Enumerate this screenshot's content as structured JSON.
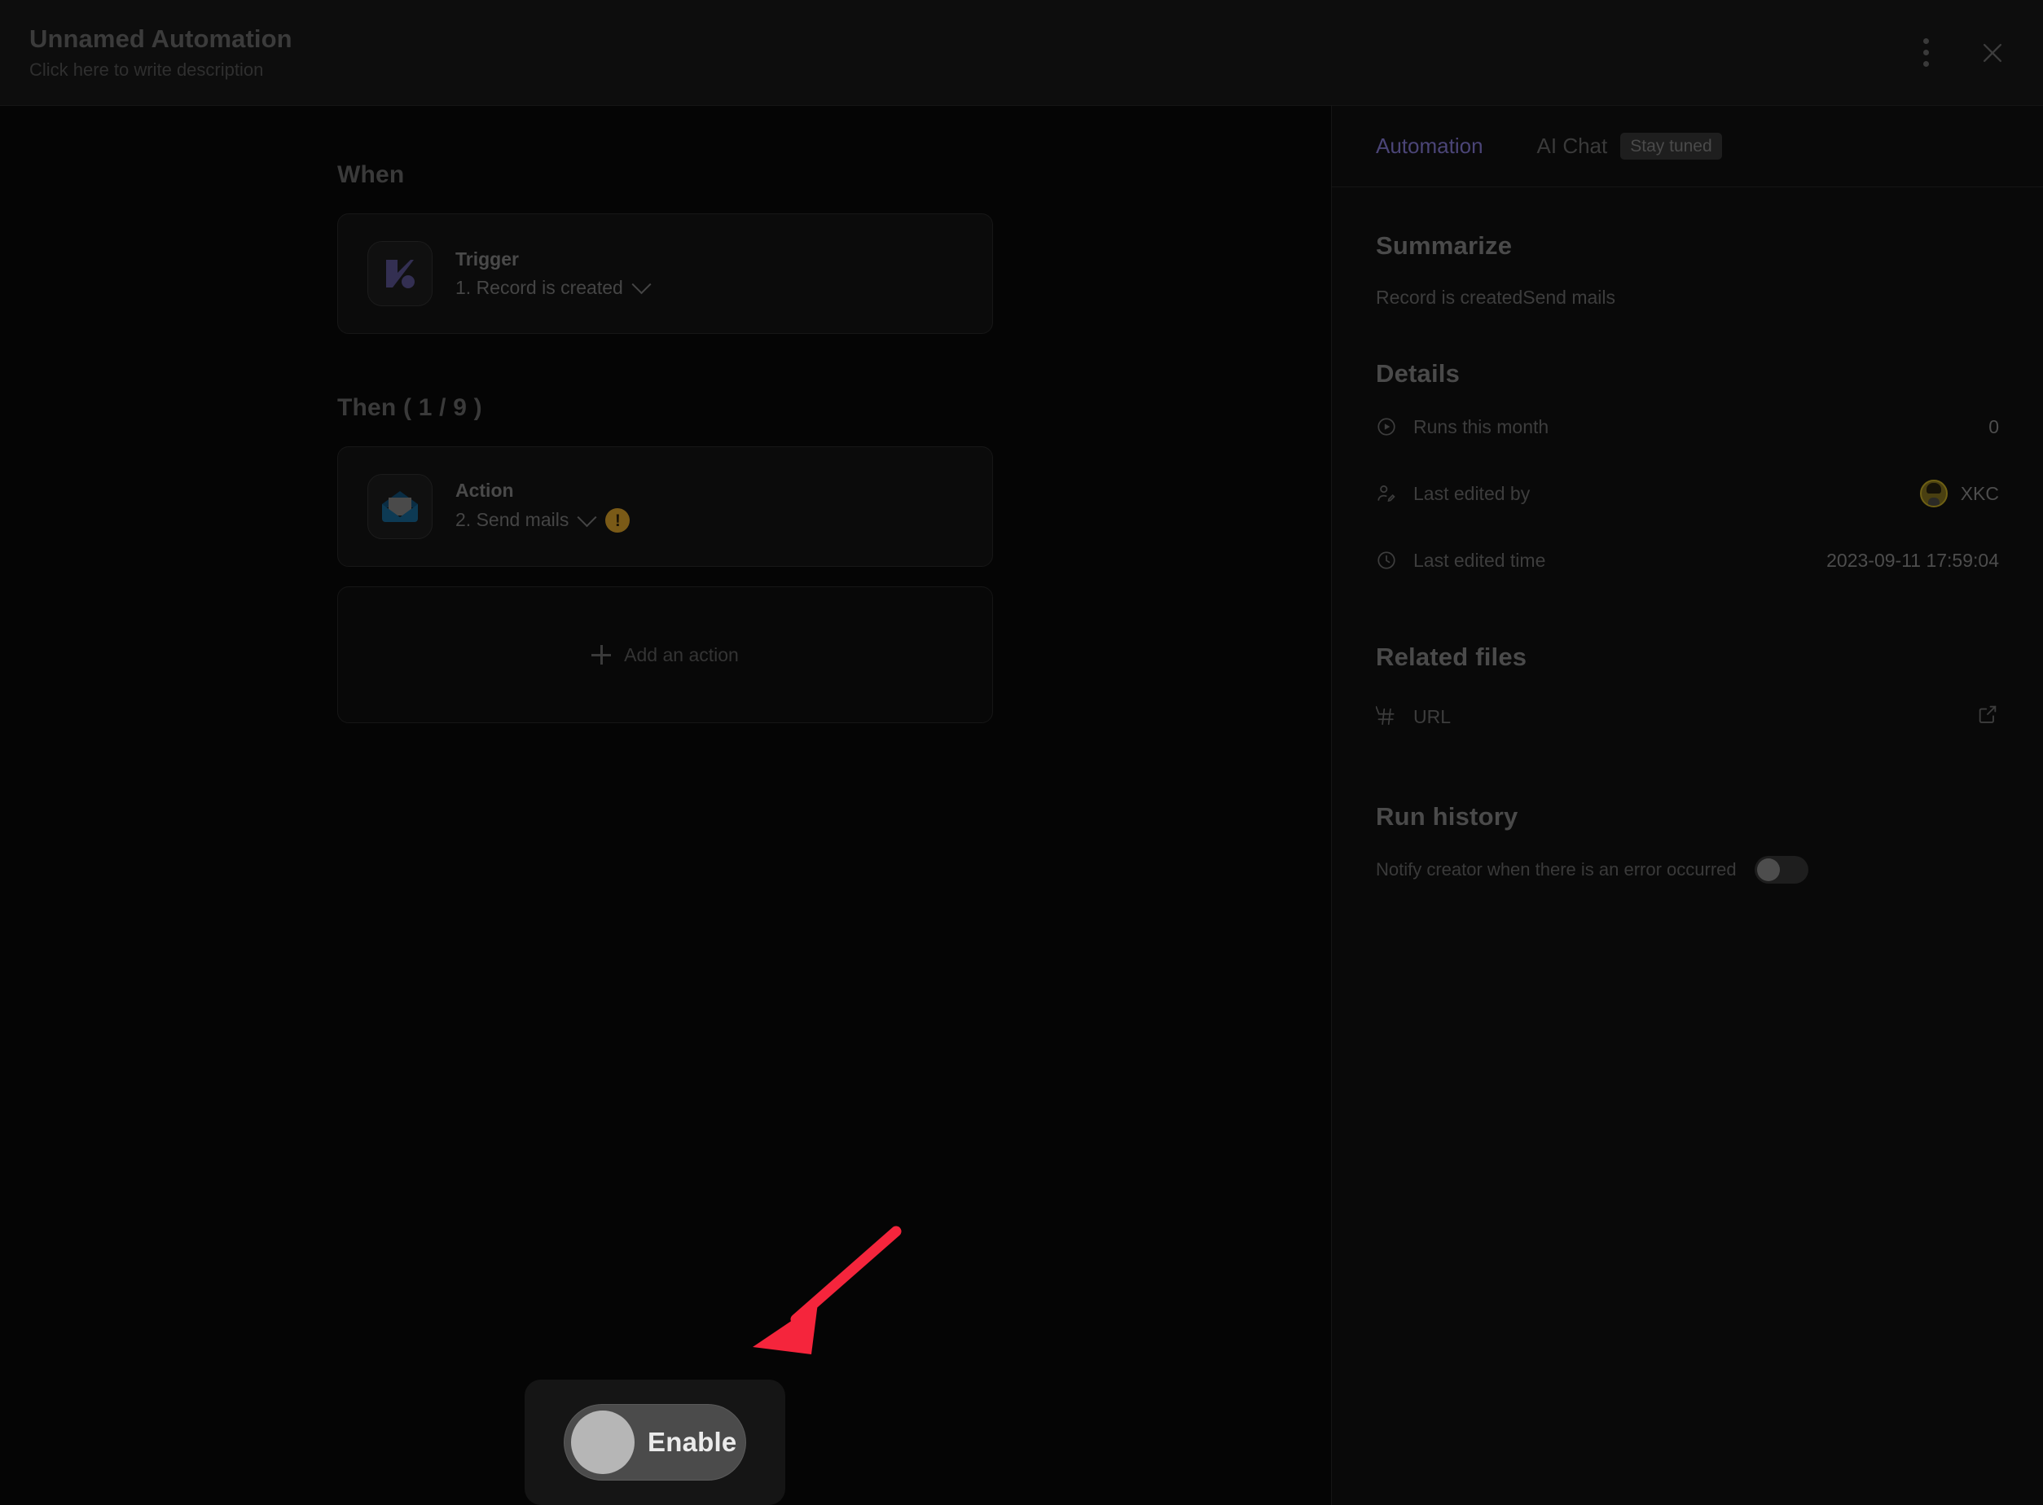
{
  "header": {
    "title": "Unnamed Automation",
    "description": "Click here to write description",
    "more_icon": "kebab-menu-icon",
    "close_icon": "close-icon"
  },
  "flow": {
    "when_title": "When",
    "trigger": {
      "icon": "trigger-logo-icon",
      "label": "Trigger",
      "value": "1. Record is created",
      "chevron": "chevron-down-icon"
    },
    "then_title": "Then ( 1 / 9 )",
    "action": {
      "icon": "envelope-icon",
      "label": "Action",
      "value": "2. Send mails",
      "chevron": "chevron-down-icon",
      "warning": "!",
      "warning_color": "#7a5a17"
    },
    "add_action_label": "Add an action",
    "add_action_icon": "plus-icon"
  },
  "panel": {
    "tabs": [
      {
        "label": "Automation",
        "active": true
      },
      {
        "label": "AI Chat",
        "active": false,
        "badge": "Stay tuned"
      }
    ],
    "active_tab_color": "#4b4577",
    "summarize": {
      "heading": "Summarize",
      "text": "Record is createdSend mails"
    },
    "details": {
      "heading": "Details",
      "rows": [
        {
          "icon": "play-circle-icon",
          "label": "Runs this month",
          "value": "0"
        },
        {
          "icon": "user-edit-icon",
          "label": "Last edited by",
          "value": "XKC",
          "avatar": "user-avatar"
        },
        {
          "icon": "clock-icon",
          "label": "Last edited time",
          "value": "2023-09-11 17:59:04"
        }
      ]
    },
    "related_files": {
      "heading": "Related files",
      "rows": [
        {
          "icon": "hash-icon",
          "label": "URL",
          "action_icon": "external-link-icon"
        }
      ]
    },
    "run_history": {
      "heading": "Run history",
      "notify_label": "Notify creator when there is an error occurred",
      "notify_on": false
    }
  },
  "enable": {
    "label": "Enable",
    "state_on": false
  },
  "annotation": {
    "arrow_color": "#f5253c",
    "type": "arrow-pointing-to-enable-toggle"
  }
}
